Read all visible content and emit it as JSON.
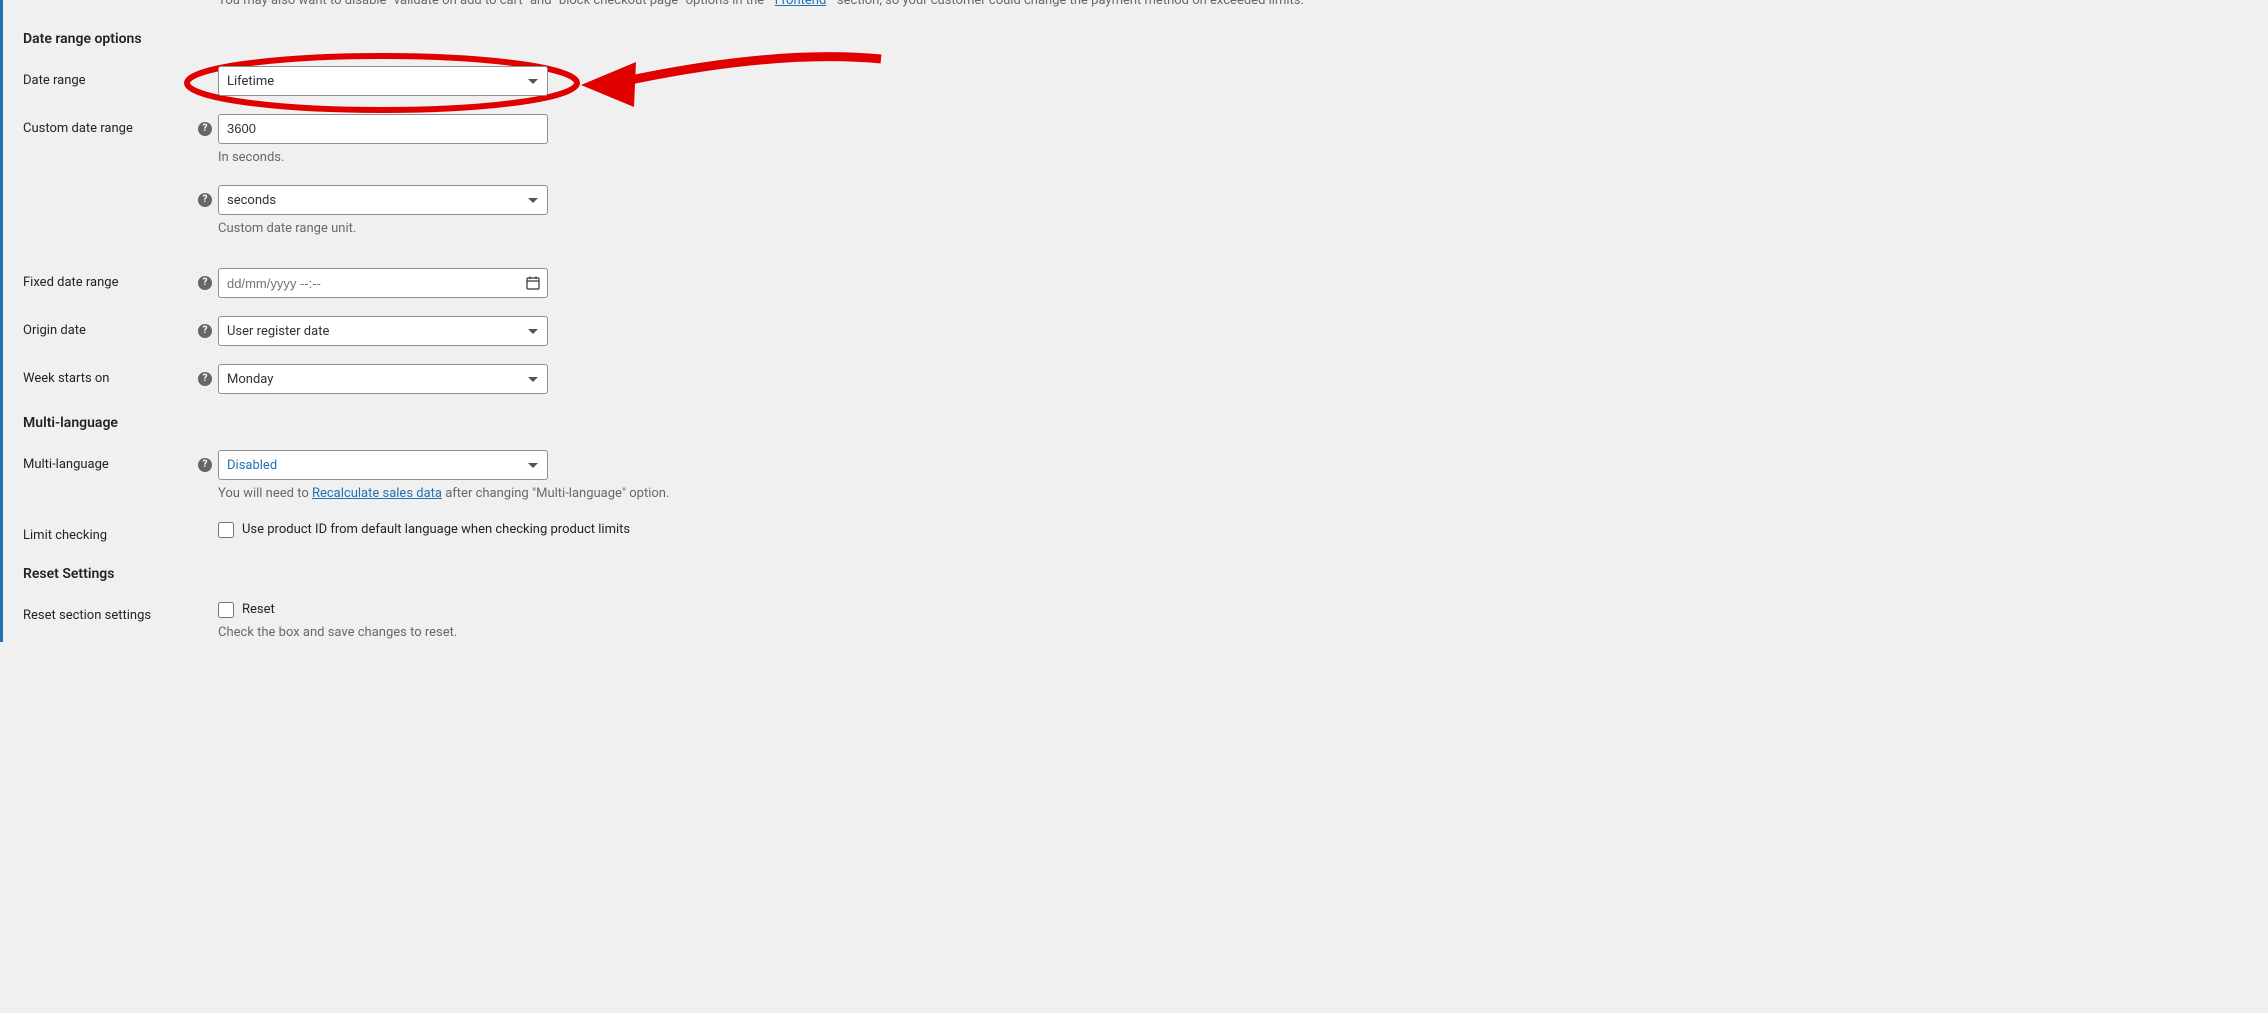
{
  "top_note": {
    "prefix": "You may also want to disable \"validate on add to cart\" and \"block checkout page\" options in the \"",
    "link": "Frontend",
    "suffix": "\" section, so your customer could change the payment method on exceeded limits."
  },
  "sections": {
    "date_range_options": {
      "title": "Date range options",
      "date_range": {
        "label": "Date range",
        "value": "Lifetime"
      },
      "custom_date_range": {
        "label": "Custom date range",
        "value": "3600",
        "hint": "In seconds."
      },
      "custom_unit": {
        "value": "seconds",
        "hint": "Custom date range unit."
      },
      "fixed_date_range": {
        "label": "Fixed date range",
        "placeholder": "dd/mm/yyyy --:--"
      },
      "origin_date": {
        "label": "Origin date",
        "value": "User register date"
      },
      "week_starts": {
        "label": "Week starts on",
        "value": "Monday"
      }
    },
    "multi_language": {
      "title": "Multi-language",
      "multi_language_field": {
        "label": "Multi-language",
        "value": "Disabled",
        "hint_prefix": "You will need to ",
        "hint_link": "Recalculate sales data",
        "hint_suffix": " after changing \"Multi-language\" option."
      },
      "limit_checking": {
        "label": "Limit checking",
        "checkbox_label": "Use product ID from default language when checking product limits"
      }
    },
    "reset_settings": {
      "title": "Reset Settings",
      "reset_section": {
        "label": "Reset section settings",
        "checkbox_label": "Reset",
        "hint": "Check the box and save changes to reset."
      }
    }
  }
}
